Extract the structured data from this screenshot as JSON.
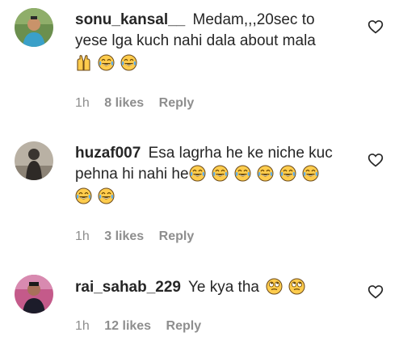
{
  "comments": [
    {
      "username": "sonu_kansal__",
      "text_line1": "Medam,,,20sec to",
      "text_line2": "yese lga kuch nahi dala about mala",
      "emojis_line3": [
        "raising-hands-emoji",
        "tears-of-joy-emoji",
        "tears-of-joy-emoji"
      ],
      "time": "1h",
      "likes": "8 likes",
      "reply": "Reply"
    },
    {
      "username": "huzaf007",
      "text_line1": "Esa lagrha he ke niche kuc",
      "text_line2": "pehna hi nahi he",
      "emojis_line2": [
        "rolling-laughing-emoji",
        "rolling-laughing-emoji",
        "rolling-laughing-emoji",
        "rolling-laughing-emoji",
        "rolling-laughing-emoji",
        "rolling-laughing-emoji"
      ],
      "emojis_line3": [
        "rolling-laughing-emoji",
        "rolling-laughing-emoji"
      ],
      "time": "1h",
      "likes": "3 likes",
      "reply": "Reply"
    },
    {
      "username": "rai_sahab_229",
      "text_line1": "Ye kya tha",
      "emojis_line1": [
        "rolling-eyes-emoji",
        "rolling-eyes-emoji"
      ],
      "time": "1h",
      "likes": "12 likes",
      "reply": "Reply"
    }
  ],
  "colors": {
    "text": "#262626",
    "secondary": "#8e8e8e",
    "emoji_face": "#FFCC4D",
    "tear": "#5DADEC"
  }
}
